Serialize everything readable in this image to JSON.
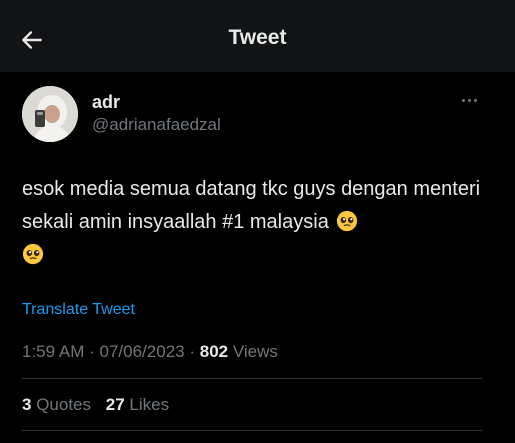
{
  "header": {
    "title": "Tweet",
    "back_icon": "arrow-left-icon"
  },
  "author": {
    "name": "adr",
    "handle": "@adrianafaedzal"
  },
  "tweet": {
    "text": "esok media semua datang tkc guys dengan menteri sekali amin insyaallah #1 malaysia",
    "emoji": "pleading-face-icon",
    "translate_label": "Translate Tweet"
  },
  "meta": {
    "time": "1:59 AM",
    "separator": "·",
    "date": "07/06/2023",
    "views_count": "802",
    "views_label": "Views"
  },
  "stats": {
    "quotes_count": "3",
    "quotes_label": "Quotes",
    "likes_count": "27",
    "likes_label": "Likes"
  },
  "colors": {
    "background": "#000000",
    "text": "#e7e9ea",
    "secondary_text": "#71767b",
    "accent": "#1d9bf0"
  }
}
